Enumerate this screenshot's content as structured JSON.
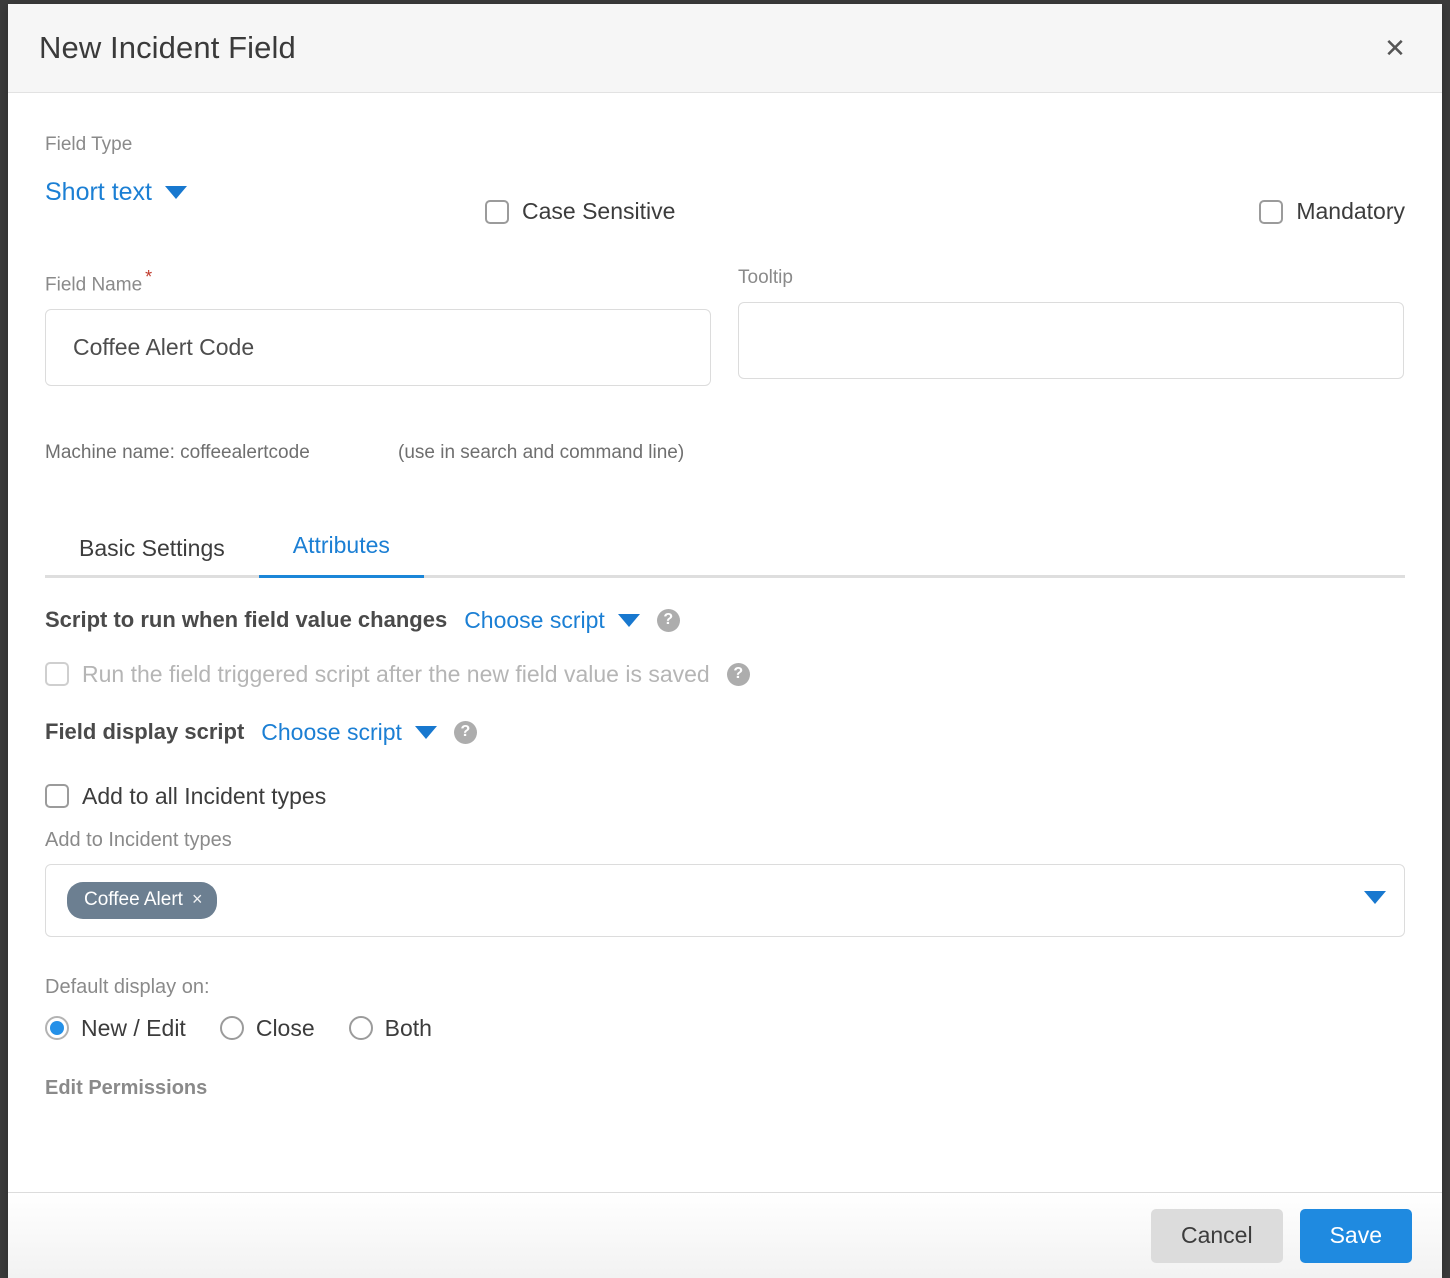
{
  "modal": {
    "title": "New Incident Field",
    "close_icon": "close-icon"
  },
  "field_type": {
    "label": "Field Type",
    "value": "Short text",
    "caret_icon": "chevron-down-icon"
  },
  "case_sensitive": {
    "label": "Case Sensitive",
    "checked": false
  },
  "mandatory": {
    "label": "Mandatory",
    "checked": false
  },
  "field_name": {
    "label": "Field Name",
    "required_marker": "*",
    "value": "Coffee Alert Code",
    "placeholder": ""
  },
  "tooltip": {
    "label": "Tooltip",
    "value": "",
    "placeholder": ""
  },
  "machine": {
    "text": "Machine name: coffeealertcode",
    "hint": "(use in search and command line)"
  },
  "tabs": [
    {
      "label": "Basic Settings",
      "active": false
    },
    {
      "label": "Attributes",
      "active": true
    }
  ],
  "attributes": {
    "script_on_change": {
      "label": "Script to run when field value changes",
      "select_value": "Choose script",
      "help_icon": "help-icon"
    },
    "run_after_save": {
      "label": "Run the field triggered script after the new field value is saved",
      "checked": false,
      "disabled": true,
      "help_icon": "help-icon"
    },
    "field_display_script": {
      "label": "Field display script",
      "select_value": "Choose script",
      "help_icon": "help-icon"
    },
    "add_to_all": {
      "label": "Add to all Incident types",
      "checked": false
    },
    "add_to_types": {
      "label": "Add to Incident types",
      "chips": [
        {
          "label": "Coffee Alert",
          "remove_icon": "×"
        }
      ],
      "caret_icon": "chevron-down-icon"
    },
    "default_display": {
      "label": "Default display on:",
      "options": [
        {
          "label": "New / Edit",
          "selected": true
        },
        {
          "label": "Close",
          "selected": false
        },
        {
          "label": "Both",
          "selected": false
        }
      ]
    },
    "edit_permissions": {
      "label": "Edit Permissions"
    }
  },
  "footer": {
    "cancel_label": "Cancel",
    "save_label": "Save"
  },
  "colors": {
    "accent_blue": "#1b7fd4",
    "save_blue": "#1f8ae0",
    "chip_slate": "#6c7f91",
    "required_red": "#c0392b"
  }
}
